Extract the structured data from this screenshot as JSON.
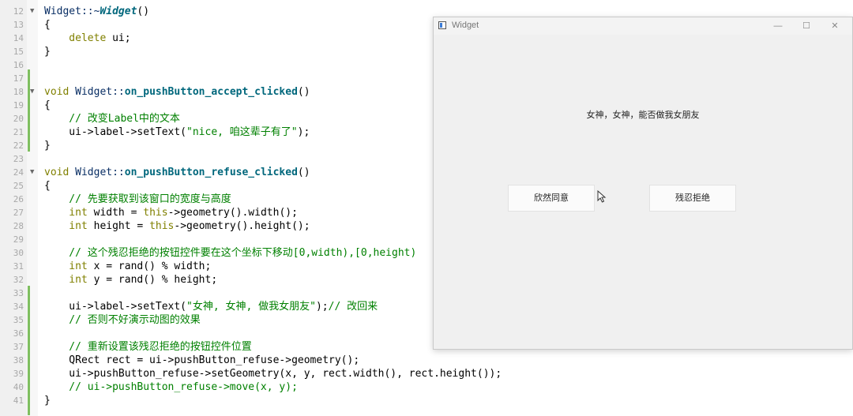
{
  "editor": {
    "lines": [
      {
        "num": "12",
        "fold": true,
        "parts": [
          {
            "t": "Widget::~",
            "c": "vr"
          },
          {
            "t": "Widget",
            "c": "fn it"
          },
          {
            "t": "()",
            "c": ""
          }
        ]
      },
      {
        "num": "13",
        "fold": false,
        "parts": [
          {
            "t": "{",
            "c": ""
          }
        ]
      },
      {
        "num": "14",
        "fold": false,
        "parts": [
          {
            "t": "    delete ",
            "c": "kw"
          },
          {
            "t": "ui;",
            "c": ""
          }
        ]
      },
      {
        "num": "15",
        "fold": false,
        "parts": [
          {
            "t": "}",
            "c": ""
          }
        ]
      },
      {
        "num": "16",
        "fold": false,
        "parts": []
      },
      {
        "num": "17",
        "fold": false,
        "parts": []
      },
      {
        "num": "18",
        "fold": true,
        "parts": [
          {
            "t": "void ",
            "c": "kw"
          },
          {
            "t": "Widget::",
            "c": "vr"
          },
          {
            "t": "on_pushButton_accept_clicked",
            "c": "fn"
          },
          {
            "t": "()",
            "c": ""
          }
        ]
      },
      {
        "num": "19",
        "fold": false,
        "parts": [
          {
            "t": "{",
            "c": ""
          }
        ]
      },
      {
        "num": "20",
        "fold": false,
        "parts": [
          {
            "t": "    // 改变Label中的文本",
            "c": "cm"
          }
        ]
      },
      {
        "num": "21",
        "fold": false,
        "parts": [
          {
            "t": "    ui->label->setText(",
            "c": ""
          },
          {
            "t": "\"nice, 咱这辈子有了\"",
            "c": "str"
          },
          {
            "t": ");",
            "c": ""
          }
        ]
      },
      {
        "num": "22",
        "fold": false,
        "parts": [
          {
            "t": "}",
            "c": ""
          }
        ]
      },
      {
        "num": "23",
        "fold": false,
        "parts": []
      },
      {
        "num": "24",
        "fold": true,
        "parts": [
          {
            "t": "void ",
            "c": "kw"
          },
          {
            "t": "Widget::",
            "c": "vr"
          },
          {
            "t": "on_pushButton_refuse_clicked",
            "c": "fn"
          },
          {
            "t": "()",
            "c": ""
          }
        ]
      },
      {
        "num": "25",
        "fold": false,
        "parts": [
          {
            "t": "{",
            "c": ""
          }
        ]
      },
      {
        "num": "26",
        "fold": false,
        "parts": [
          {
            "t": "    // 先要获取到该窗口的宽度与高度",
            "c": "cm"
          }
        ]
      },
      {
        "num": "27",
        "fold": false,
        "parts": [
          {
            "t": "    int ",
            "c": "kw"
          },
          {
            "t": "width = ",
            "c": ""
          },
          {
            "t": "this",
            "c": "kw"
          },
          {
            "t": "->geometry().width();",
            "c": ""
          }
        ]
      },
      {
        "num": "28",
        "fold": false,
        "parts": [
          {
            "t": "    int ",
            "c": "kw"
          },
          {
            "t": "height = ",
            "c": ""
          },
          {
            "t": "this",
            "c": "kw"
          },
          {
            "t": "->geometry().height();",
            "c": ""
          }
        ]
      },
      {
        "num": "29",
        "fold": false,
        "parts": []
      },
      {
        "num": "30",
        "fold": false,
        "parts": [
          {
            "t": "    // 这个残忍拒绝的按钮控件要在这个坐标下移动[0,width),[0,height)",
            "c": "cm"
          }
        ]
      },
      {
        "num": "31",
        "fold": false,
        "parts": [
          {
            "t": "    int ",
            "c": "kw"
          },
          {
            "t": "x = rand() % width;",
            "c": ""
          }
        ]
      },
      {
        "num": "32",
        "fold": false,
        "parts": [
          {
            "t": "    int ",
            "c": "kw"
          },
          {
            "t": "y = rand() % height;",
            "c": ""
          }
        ]
      },
      {
        "num": "33",
        "fold": false,
        "parts": []
      },
      {
        "num": "34",
        "fold": false,
        "parts": [
          {
            "t": "    ui->label->setText(",
            "c": ""
          },
          {
            "t": "\"女神, 女神, 做我女朋友\"",
            "c": "str"
          },
          {
            "t": ");",
            "c": ""
          },
          {
            "t": "// 改回来",
            "c": "cm"
          }
        ]
      },
      {
        "num": "35",
        "fold": false,
        "parts": [
          {
            "t": "    // 否则不好演示动图的效果",
            "c": "cm"
          }
        ]
      },
      {
        "num": "36",
        "fold": false,
        "parts": []
      },
      {
        "num": "37",
        "fold": false,
        "parts": [
          {
            "t": "    // 重新设置该残忍拒绝的按钮控件位置",
            "c": "cm"
          }
        ]
      },
      {
        "num": "38",
        "fold": false,
        "parts": [
          {
            "t": "    QRect rect = ui->pushButton_refuse->geometry();",
            "c": ""
          }
        ]
      },
      {
        "num": "39",
        "fold": false,
        "parts": [
          {
            "t": "    ui->pushButton_refuse->setGeometry(x, y, rect.width(), rect.height());",
            "c": ""
          }
        ]
      },
      {
        "num": "40",
        "fold": false,
        "parts": [
          {
            "t": "    // ui->pushButton_refuse->move(x, y);",
            "c": "cm"
          }
        ]
      },
      {
        "num": "41",
        "fold": false,
        "parts": [
          {
            "t": "}",
            "c": ""
          }
        ]
      }
    ]
  },
  "window": {
    "title": "Widget",
    "minimize_glyph": "—",
    "maximize_glyph": "☐",
    "close_glyph": "✕",
    "label_text": "女神，女神，能否做我女朋友",
    "accept_label": "欣然同意",
    "refuse_label": "残忍拒绝"
  },
  "icons": {
    "app": "app-window-icon",
    "cursor": "mouse-cursor-icon"
  }
}
